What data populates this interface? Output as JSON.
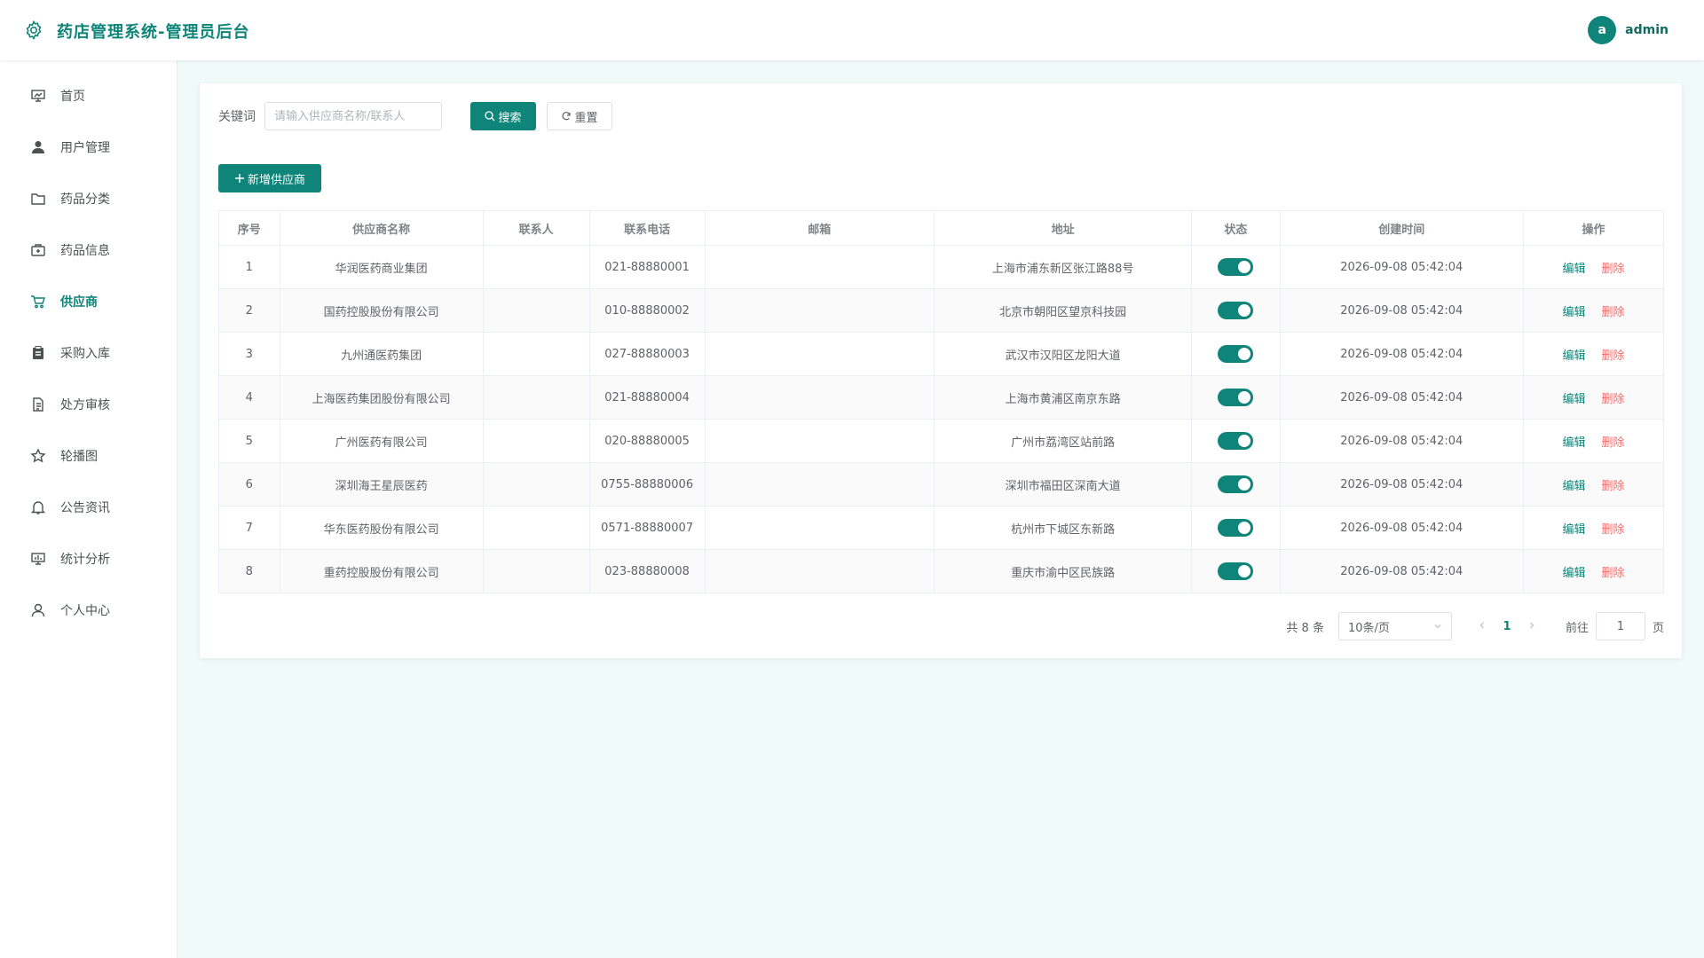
{
  "header": {
    "title": "药店管理系统-管理员后台",
    "avatar_letter": "a",
    "username": "admin"
  },
  "sidebar": {
    "items": [
      {
        "label": "首页",
        "icon": "chart-board-icon"
      },
      {
        "label": "用户管理",
        "icon": "user-filled-icon"
      },
      {
        "label": "药品分类",
        "icon": "folder-icon"
      },
      {
        "label": "药品信息",
        "icon": "medicine-box-icon"
      },
      {
        "label": "供应商",
        "icon": "cart-icon",
        "active": true
      },
      {
        "label": "采购入库",
        "icon": "clipboard-icon"
      },
      {
        "label": "处方审核",
        "icon": "document-icon"
      },
      {
        "label": "轮播图",
        "icon": "star-icon"
      },
      {
        "label": "公告资讯",
        "icon": "bell-icon"
      },
      {
        "label": "统计分析",
        "icon": "data-board-icon"
      },
      {
        "label": "个人中心",
        "icon": "user-icon"
      }
    ]
  },
  "search": {
    "label": "关键词",
    "placeholder": "请输入供应商名称/联系人",
    "value": "",
    "search_label": "搜索",
    "reset_label": "重置"
  },
  "actions": {
    "add_label": "新增供应商"
  },
  "table": {
    "headers": [
      "序号",
      "供应商名称",
      "联系人",
      "联系电话",
      "邮箱",
      "地址",
      "状态",
      "创建时间",
      "操作"
    ],
    "edit_label": "编辑",
    "delete_label": "删除",
    "rows": [
      {
        "index": "1",
        "name": "华润医药商业集团",
        "contact": "",
        "phone": "021-88880001",
        "email": "",
        "address": "上海市浦东新区张江路88号",
        "status": true,
        "created": "2026-09-08 05:42:04"
      },
      {
        "index": "2",
        "name": "国药控股股份有限公司",
        "contact": "",
        "phone": "010-88880002",
        "email": "",
        "address": "北京市朝阳区望京科技园",
        "status": true,
        "created": "2026-09-08 05:42:04"
      },
      {
        "index": "3",
        "name": "九州通医药集团",
        "contact": "",
        "phone": "027-88880003",
        "email": "",
        "address": "武汉市汉阳区龙阳大道",
        "status": true,
        "created": "2026-09-08 05:42:04"
      },
      {
        "index": "4",
        "name": "上海医药集团股份有限公司",
        "contact": "",
        "phone": "021-88880004",
        "email": "",
        "address": "上海市黄浦区南京东路",
        "status": true,
        "created": "2026-09-08 05:42:04"
      },
      {
        "index": "5",
        "name": "广州医药有限公司",
        "contact": "",
        "phone": "020-88880005",
        "email": "",
        "address": "广州市荔湾区站前路",
        "status": true,
        "created": "2026-09-08 05:42:04"
      },
      {
        "index": "6",
        "name": "深圳海王星辰医药",
        "contact": "",
        "phone": "0755-88880006",
        "email": "",
        "address": "深圳市福田区深南大道",
        "status": true,
        "created": "2026-09-08 05:42:04"
      },
      {
        "index": "7",
        "name": "华东医药股份有限公司",
        "contact": "",
        "phone": "0571-88880007",
        "email": "",
        "address": "杭州市下城区东新路",
        "status": true,
        "created": "2026-09-08 05:42:04"
      },
      {
        "index": "8",
        "name": "重药控股股份有限公司",
        "contact": "",
        "phone": "023-88880008",
        "email": "",
        "address": "重庆市渝中区民族路",
        "status": true,
        "created": "2026-09-08 05:42:04"
      }
    ]
  },
  "pagination": {
    "total_text": "共 8 条",
    "page_size": "10条/页",
    "current_page": "1",
    "goto_label": "前往",
    "goto_value": "1",
    "page_suffix": "页"
  },
  "colors": {
    "accent": "#0f8478",
    "danger": "#f56c6c",
    "background": "#f0faf8"
  }
}
